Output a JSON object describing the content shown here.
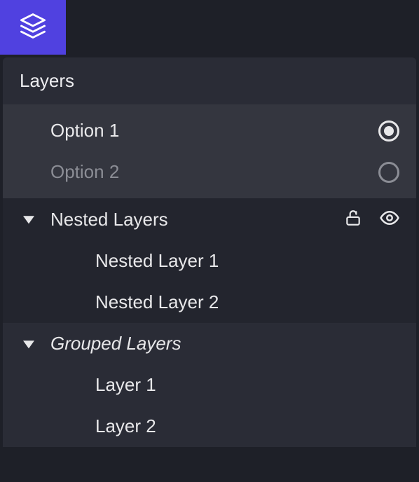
{
  "panel": {
    "title": "Layers"
  },
  "options": [
    {
      "label": "Option 1",
      "selected": true
    },
    {
      "label": "Option 2",
      "selected": false
    }
  ],
  "groups": [
    {
      "label": "Nested Layers",
      "italic": false,
      "expanded": true,
      "showActions": true,
      "children": [
        {
          "label": "Nested Layer 1"
        },
        {
          "label": "Nested Layer 2"
        }
      ]
    },
    {
      "label": "Grouped Layers",
      "italic": true,
      "expanded": true,
      "showActions": false,
      "children": [
        {
          "label": "Layer 1"
        },
        {
          "label": "Layer 2"
        }
      ]
    }
  ],
  "icons": {
    "layers": "layers-icon",
    "unlock": "unlock-icon",
    "eye": "eye-icon",
    "chevronDown": "chevron-down-icon"
  }
}
